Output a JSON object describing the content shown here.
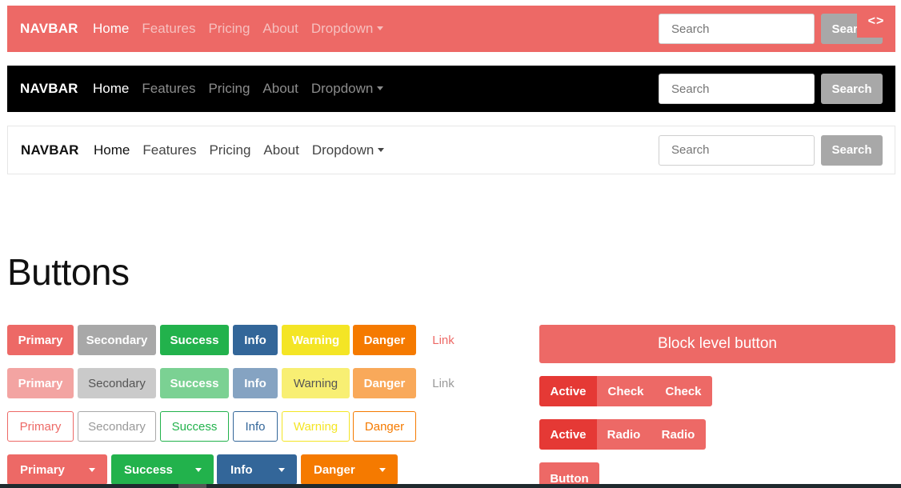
{
  "navbars": [
    {
      "brand": "NAVBAR",
      "links": [
        "Home",
        "Features",
        "Pricing",
        "About",
        "Dropdown"
      ],
      "search_placeholder": "Search",
      "search_button": "Search"
    },
    {
      "brand": "NAVBAR",
      "links": [
        "Home",
        "Features",
        "Pricing",
        "About",
        "Dropdown"
      ],
      "search_placeholder": "Search",
      "search_button": "Search"
    },
    {
      "brand": "NAVBAR",
      "links": [
        "Home",
        "Features",
        "Pricing",
        "About",
        "Dropdown"
      ],
      "search_placeholder": "Search",
      "search_button": "Search"
    }
  ],
  "code_toggle": "<>",
  "buttons_section": {
    "title": "Buttons",
    "rows": [
      [
        "Primary",
        "Secondary",
        "Success",
        "Info",
        "Warning",
        "Danger",
        "Link"
      ],
      [
        "Primary",
        "Secondary",
        "Success",
        "Info",
        "Warning",
        "Danger",
        "Link"
      ],
      [
        "Primary",
        "Secondary",
        "Success",
        "Info",
        "Warning",
        "Danger"
      ],
      [
        "Primary",
        "Success",
        "Info",
        "Danger"
      ]
    ],
    "block_button": "Block level button",
    "checkbox_group": [
      "Active",
      "Check",
      "Check"
    ],
    "radio_group": [
      "Active",
      "Radio",
      "Radio"
    ],
    "single_button": "Button"
  },
  "colors": {
    "primary": "#ed6966",
    "secondary": "#a8a8a8",
    "success": "#22b24c",
    "info": "#336699",
    "warning": "#f4e525",
    "danger": "#f57a00",
    "active": "#e53935"
  }
}
